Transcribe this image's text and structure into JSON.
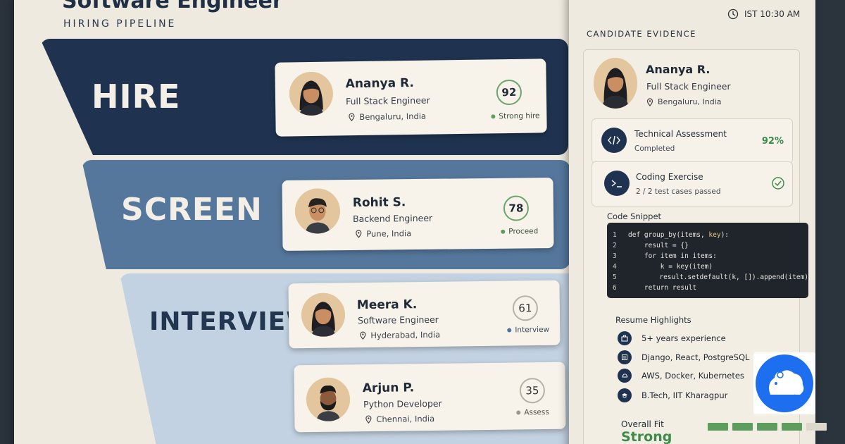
{
  "header": {
    "title": "Software Engineer",
    "subtitle": "HIRING PIPELINE",
    "clock": "IST 10:30 AM"
  },
  "stages": [
    {
      "label": "HIRE",
      "color": "#1f3350"
    },
    {
      "label": "SCREEN",
      "color": "#55779c"
    },
    {
      "label": "INTERVIEW",
      "color": "#c3d2e2"
    }
  ],
  "candidates": [
    {
      "name": "Ananya R.",
      "role": "Full Stack Engineer",
      "location": "Bengaluru, India",
      "score": "92",
      "status": "Strong hire",
      "status_color": "#3d8a4a"
    },
    {
      "name": "Rohit S.",
      "role": "Backend Engineer",
      "location": "Pune, India",
      "score": "78",
      "status": "Proceed",
      "status_color": "#3d8a4a"
    },
    {
      "name": "Meera K.",
      "role": "Software Engineer",
      "location": "Hyderabad, India",
      "score": "61",
      "status": "Interview",
      "status_color": "#4f74a0"
    },
    {
      "name": "Arjun P.",
      "role": "Python Developer",
      "location": "Chennai, India",
      "score": "35",
      "status": "Assess",
      "status_color": "#9a968d"
    }
  ],
  "evidence": {
    "heading": "CANDIDATE EVIDENCE",
    "name": "Ananya R.",
    "role": "Full Stack Engineer",
    "location": "Bengaluru, India",
    "assessments": [
      {
        "title": "Technical Assessment",
        "sub": "Completed",
        "score": "92%"
      },
      {
        "title": "Coding Exercise",
        "sub": "2 / 2 test cases passed"
      }
    ],
    "code_label": "Code Snippet",
    "code_lines": [
      {
        "n": "1",
        "pre": "def group_by(items, ",
        "hl": "key",
        "post": "):"
      },
      {
        "n": "2",
        "pre": "    result = {}",
        "hl": "",
        "post": ""
      },
      {
        "n": "3",
        "pre": "    for item in items:",
        "hl": "",
        "post": ""
      },
      {
        "n": "4",
        "pre": "        k = key(item)",
        "hl": "",
        "post": ""
      },
      {
        "n": "5",
        "pre": "        result.setdefault(k, []).append(item)",
        "hl": "",
        "post": ""
      },
      {
        "n": "6",
        "pre": "    return result",
        "hl": "",
        "post": ""
      }
    ],
    "resume_label": "Resume Highlights",
    "resume": [
      {
        "text": "5+ years experience",
        "icon": "briefcase-icon"
      },
      {
        "text": "Django, React, PostgreSQL",
        "icon": "stack-icon"
      },
      {
        "text": "AWS, Docker, Kubernetes",
        "icon": "cloud-icon"
      },
      {
        "text": "B.Tech, IIT Kharagpur",
        "icon": "graduation-icon"
      }
    ],
    "fit_label": "Overall Fit",
    "fit_value": "Strong",
    "fit_level": 0.8
  },
  "colors": {
    "accent": "#1f3350",
    "success": "#3d8a4a",
    "logo": "#1e6ff0"
  }
}
